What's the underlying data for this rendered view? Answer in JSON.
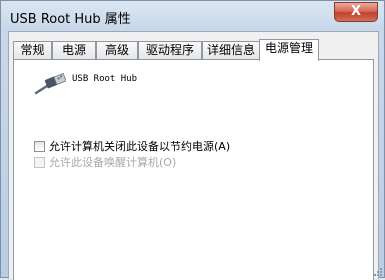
{
  "window": {
    "title": "USB Root Hub 属性",
    "close_label": "X"
  },
  "tabs": [
    {
      "label": "常规",
      "active": false
    },
    {
      "label": "电源",
      "active": false
    },
    {
      "label": "高级",
      "active": false
    },
    {
      "label": "驱动程序",
      "active": false
    },
    {
      "label": "详细信息",
      "active": false
    },
    {
      "label": "电源管理",
      "active": true
    }
  ],
  "device": {
    "name": "USB Root Hub",
    "icon": "usb-connector-icon"
  },
  "options": [
    {
      "label": "允许计算机关闭此设备以节约电源(A)",
      "checked": false,
      "enabled": true
    },
    {
      "label": "允许此设备唤醒计算机(O)",
      "checked": false,
      "enabled": false
    }
  ]
}
